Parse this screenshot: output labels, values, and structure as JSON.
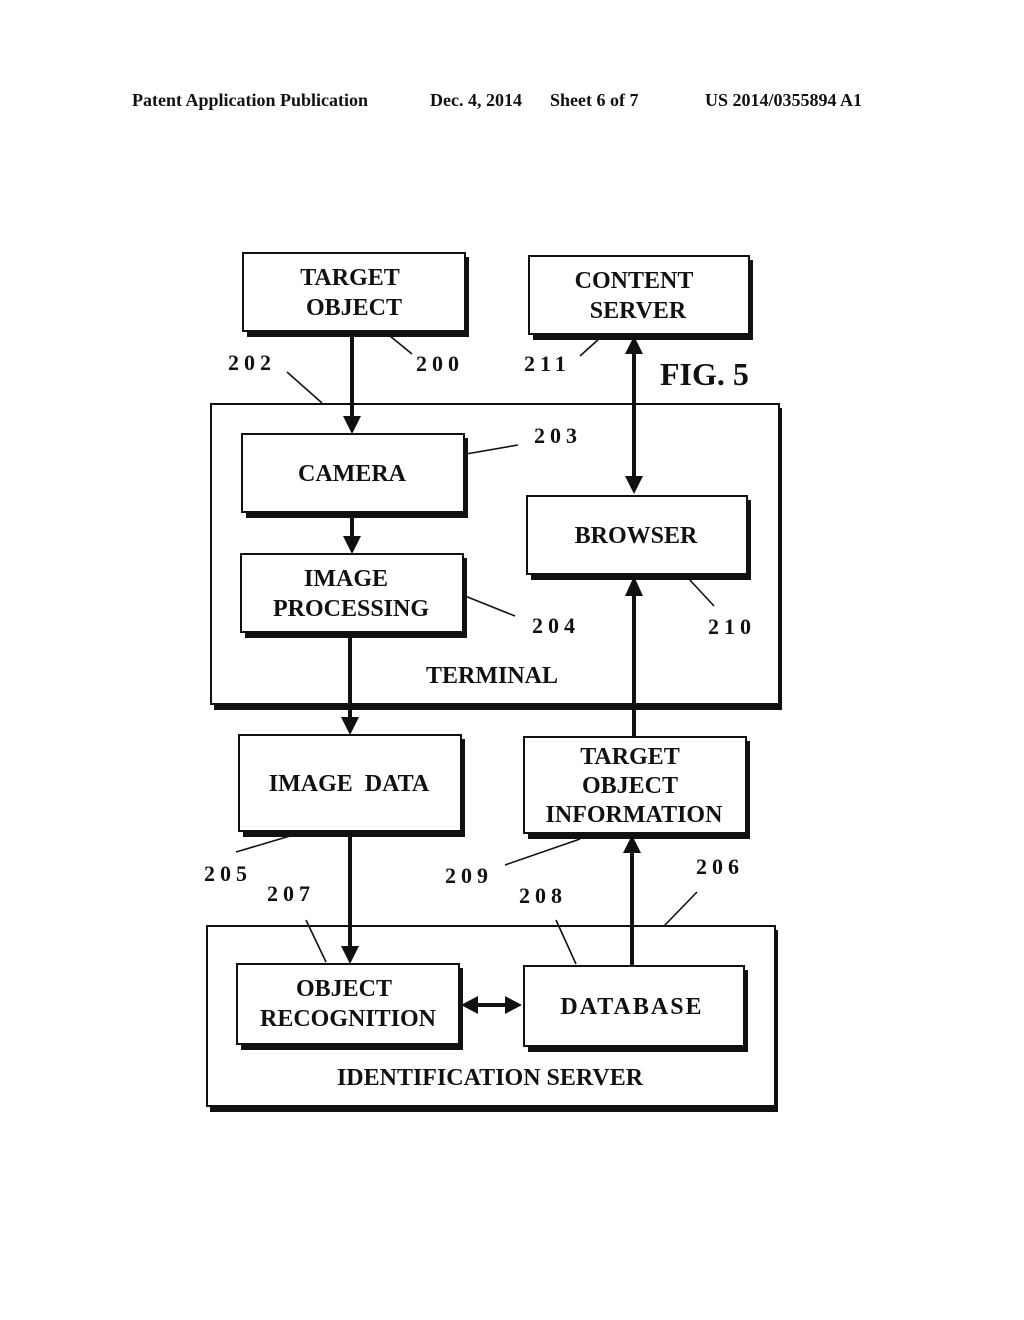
{
  "header": {
    "publication": "Patent Application Publication",
    "date": "Dec. 4, 2014",
    "sheet": "Sheet 6 of 7",
    "number": "US 2014/0355894 A1"
  },
  "figure_label": "FIG. 5",
  "blocks": {
    "target_object": [
      "TARGET",
      "OBJECT"
    ],
    "content_server": [
      "CONTENT",
      "SERVER"
    ],
    "camera": "CAMERA",
    "image_processing": [
      "IMAGE",
      "PROCESSING"
    ],
    "browser": "BROWSER",
    "terminal": "TERMINAL",
    "image_data": "IMAGE  DATA",
    "target_object_information": [
      "TARGET",
      "OBJECT",
      "INFORMATION"
    ],
    "object_recognition": [
      "OBJECT",
      "RECOGNITION"
    ],
    "database": "DATABASE",
    "identification_server": "IDENTIFICATION  SERVER"
  },
  "refs": {
    "r200": "200",
    "r202": "202",
    "r203": "203",
    "r204": "204",
    "r205": "205",
    "r206": "206",
    "r207": "207",
    "r208": "208",
    "r209": "209",
    "r210": "210",
    "r211": "211"
  }
}
